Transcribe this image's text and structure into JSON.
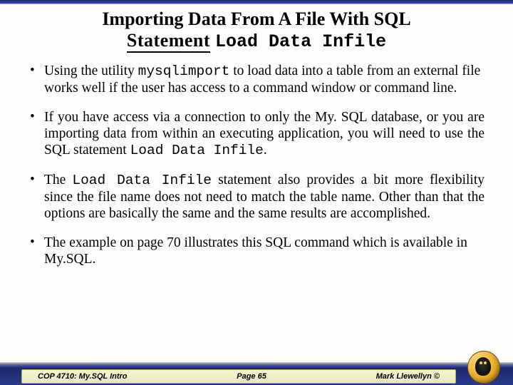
{
  "title": {
    "line1": "Importing Data From A File With SQL",
    "line2_word": "Statement",
    "line2_code": "Load Data Infile"
  },
  "bullets": {
    "b1_a": "Using the utility ",
    "b1_code": "mysqlimport",
    "b1_b": " to load data into a table from an external file works well if the user has access to a command window or command line.",
    "b2_a": "If you have access via a connection to only the My. SQL database, or you are importing data from within an executing application, you will need to use the SQL statement ",
    "b2_code": "Load Data Infile",
    "b2_b": ".",
    "b3_a": "The ",
    "b3_code": "Load Data Infile",
    "b3_b": " statement also provides a bit more flexibility since the file name does not need to match the table name.   Other than that the options are basically the same and the same results are accomplished.",
    "b4": "The example on page 70 illustrates this SQL command which is available in My.SQL."
  },
  "footer": {
    "course": "COP 4710: My.SQL Intro",
    "page": "Page 65",
    "author": "Mark Llewellyn ©"
  }
}
